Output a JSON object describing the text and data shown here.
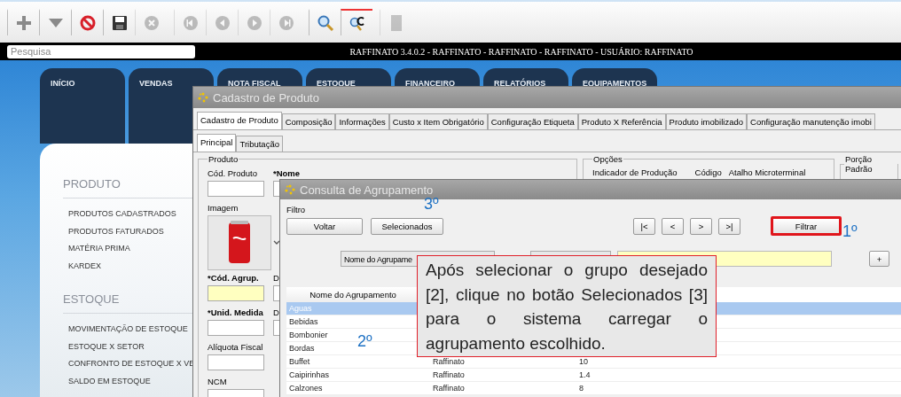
{
  "toolbar": {
    "buttons": [
      {
        "disabled": false,
        "selected": false
      },
      {
        "disabled": false,
        "selected": false
      },
      {
        "disabled": false,
        "selected": false
      },
      {
        "disabled": false,
        "selected": false
      },
      {
        "disabled": true,
        "selected": false
      },
      {
        "disabled": true,
        "selected": false
      },
      {
        "disabled": true,
        "selected": false
      },
      {
        "disabled": true,
        "selected": false
      },
      {
        "disabled": true,
        "selected": false
      },
      {
        "disabled": false,
        "selected": false
      },
      {
        "disabled": false,
        "selected": true
      },
      {
        "disabled": true,
        "selected": false
      }
    ]
  },
  "search": {
    "placeholder": "Pesquisa"
  },
  "app_title": "RAFFINATO 3.4.0.2 - RAFFINATO - RAFFINATO - RAFFINATO - USUÁRIO: RAFFINATO",
  "nav_tabs": [
    "INÍCIO",
    "VENDAS",
    "NOTA FISCAL",
    "ESTOQUE",
    "FINANCEIRO",
    "RELATÓRIOS",
    "EQUIPAMENTOS"
  ],
  "sidebar": {
    "sections": [
      {
        "title": "PRODUTO",
        "items": [
          "PRODUTOS CADASTRADOS",
          "PRODUTOS FATURADOS",
          "MATÉRIA PRIMA",
          "KARDEX"
        ]
      },
      {
        "title": "ESTOQUE",
        "items": [
          "MOVIMENTAÇÃO DE ESTOQUE",
          "ESTOQUE X SETOR",
          "CONFRONTO DE ESTOQUE X VE",
          "SALDO EM ESTOQUE"
        ]
      }
    ]
  },
  "product_window": {
    "title": "Cadastro de Produto",
    "tabs": [
      {
        "label": "Cadastro de Produto",
        "selected": true
      },
      {
        "label": "Composição",
        "selected": false
      },
      {
        "label": "Informações",
        "selected": false
      },
      {
        "label": "Custo x Item Obrigatório",
        "selected": false
      },
      {
        "label": "Configuração Etiqueta",
        "selected": false
      },
      {
        "label": "Produto X Referência",
        "selected": false
      },
      {
        "label": "Produto imobilizado",
        "selected": false
      },
      {
        "label": "Configuração manutenção imobi",
        "selected": false
      }
    ],
    "subtabs": [
      {
        "label": "Principal",
        "selected": true
      },
      {
        "label": "Tributação",
        "selected": false
      }
    ],
    "produto": {
      "title": "Produto",
      "rows": [
        {
          "kind": "field",
          "label": "Cód. Produto",
          "required": false,
          "highlighted": false,
          "side": {
            "label": "*Nome",
            "required": true
          }
        },
        {
          "kind": "image",
          "label": "Imagem"
        },
        {
          "kind": "field",
          "label": "*Cód. Agrup.",
          "required": true,
          "highlighted": true,
          "side": {
            "label": "D",
            "required": false
          }
        },
        {
          "kind": "field",
          "label": "*Unid. Medida",
          "required": true,
          "highlighted": false,
          "side": {
            "label": "D",
            "required": false
          }
        },
        {
          "kind": "field",
          "label": "Alíquota Fiscal",
          "required": false,
          "highlighted": false
        },
        {
          "kind": "field",
          "label": "NCM",
          "required": false,
          "highlighted": false
        }
      ]
    },
    "opcoes": {
      "title": "Opções",
      "labels": [
        "Indicador de Produção",
        "Código",
        "Atalho Microterminal"
      ]
    },
    "porcao": {
      "title": "Porção Padrão"
    }
  },
  "lookup_window": {
    "title": "Consulta de Agrupamento",
    "filter_label": "Filtro",
    "buttons": [
      "Voltar",
      "Selecionados"
    ],
    "pager": [
      "|<",
      "<",
      ">",
      ">|"
    ],
    "filter_button": {
      "label": "Filtrar",
      "highlighted": true
    },
    "field_select": "Nome do Agrupame",
    "add_button": "+",
    "table": {
      "columns": [
        "Nome do Agrupamento"
      ],
      "rows": [
        {
          "cells": [
            "Aguas"
          ],
          "selected": true
        },
        {
          "cells": [
            "Bebidas"
          ],
          "selected": false
        },
        {
          "cells": [
            "Bombonier"
          ],
          "selected": false
        },
        {
          "cells": [
            "Bordas"
          ],
          "selected": false
        },
        {
          "cells": [
            "Buffet",
            "Raffinato",
            "10"
          ],
          "selected": false
        },
        {
          "cells": [
            "Caipirinhas",
            "Raffinato",
            "1.4"
          ],
          "selected": false
        },
        {
          "cells": [
            "Calzones",
            "Raffinato",
            "8"
          ],
          "selected": false
        }
      ]
    }
  },
  "callout": "Após selecionar o grupo desejado [2], clique no botão Selecionados [3] para o sistema carregar o agrupamento escolhido.",
  "annotations": [
    "1º",
    "2º",
    "3º"
  ]
}
